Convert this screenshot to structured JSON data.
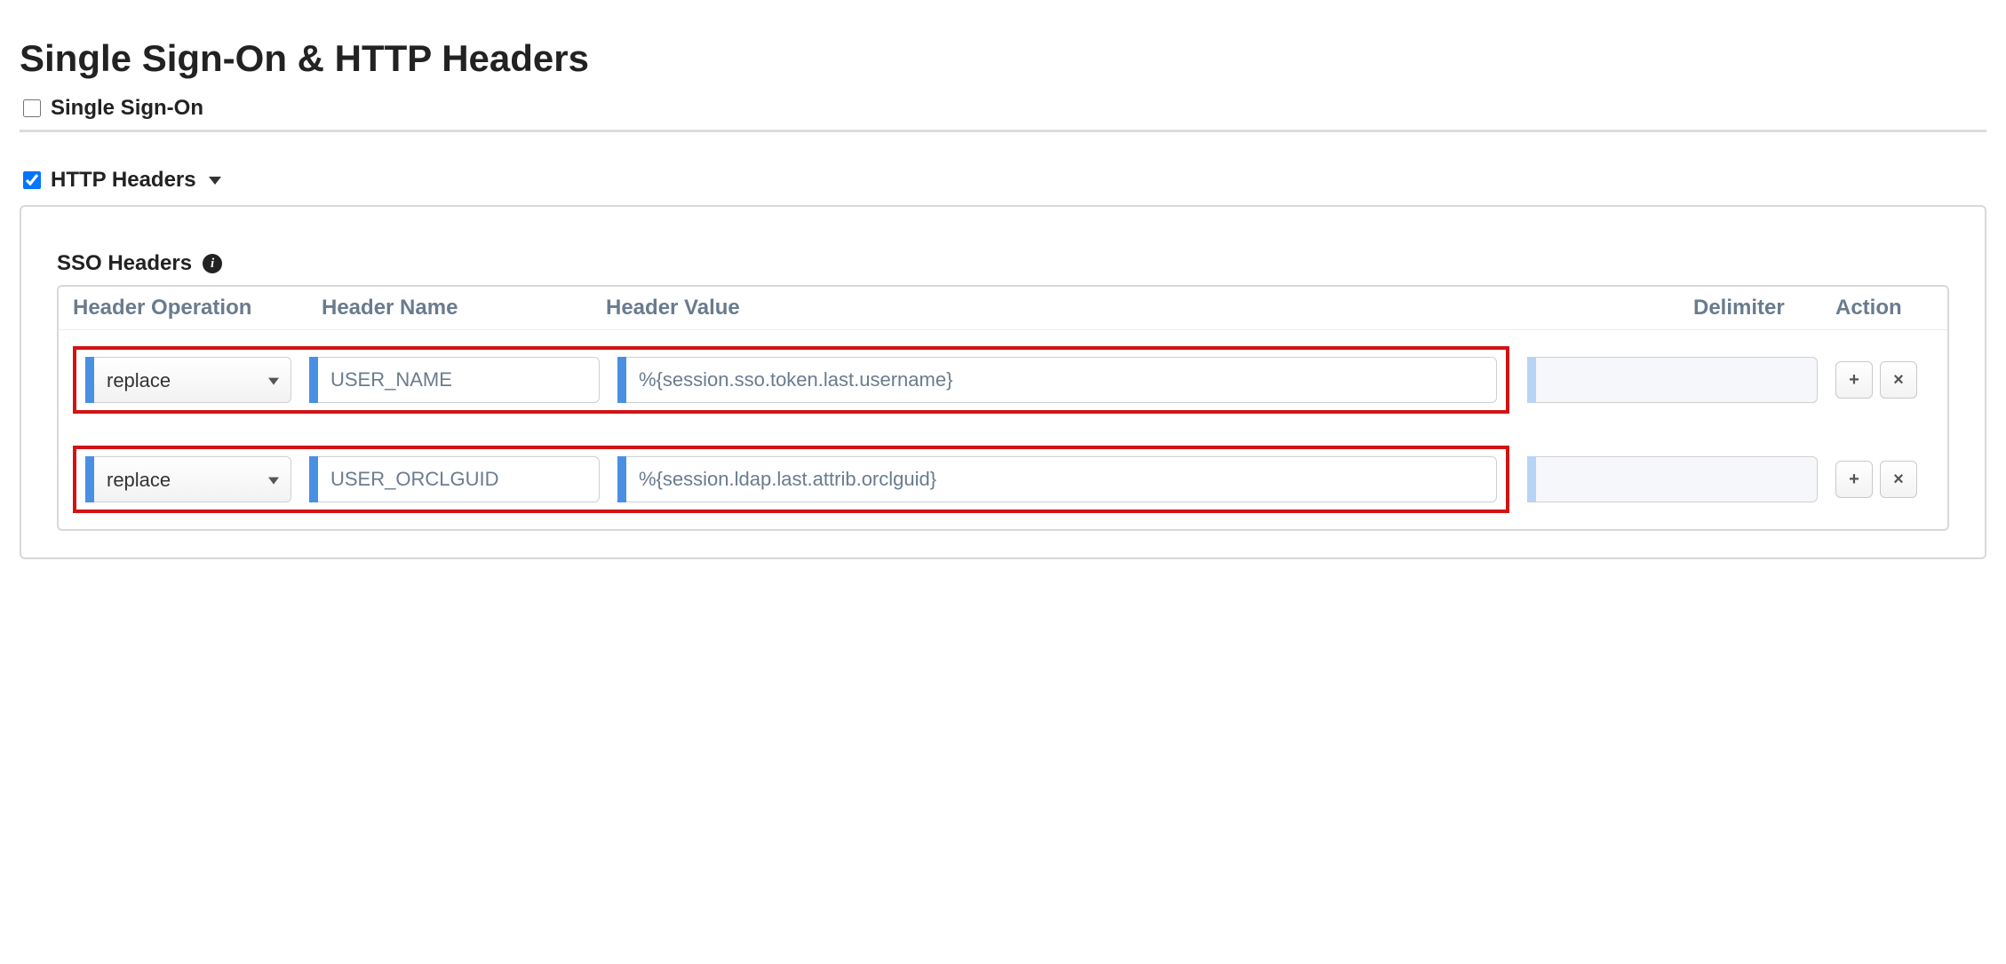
{
  "page": {
    "title": "Single Sign-On & HTTP Headers"
  },
  "sections": {
    "sso": {
      "label": "Single Sign-On",
      "checked": false
    },
    "http_headers": {
      "label": "HTTP Headers",
      "checked": true
    }
  },
  "panel": {
    "heading": "SSO Headers",
    "columns": {
      "operation": "Header Operation",
      "name": "Header Name",
      "value": "Header Value",
      "delimiter": "Delimiter",
      "action": "Action"
    },
    "rows": [
      {
        "operation": "replace",
        "name": "USER_NAME",
        "value": "%{session.sso.token.last.username}",
        "delimiter": ""
      },
      {
        "operation": "replace",
        "name": "USER_ORCLGUID",
        "value": "%{session.ldap.last.attrib.orclguid}",
        "delimiter": ""
      }
    ],
    "actions": {
      "add_title": "+",
      "remove_title": "×"
    },
    "info_tooltip": "i"
  }
}
